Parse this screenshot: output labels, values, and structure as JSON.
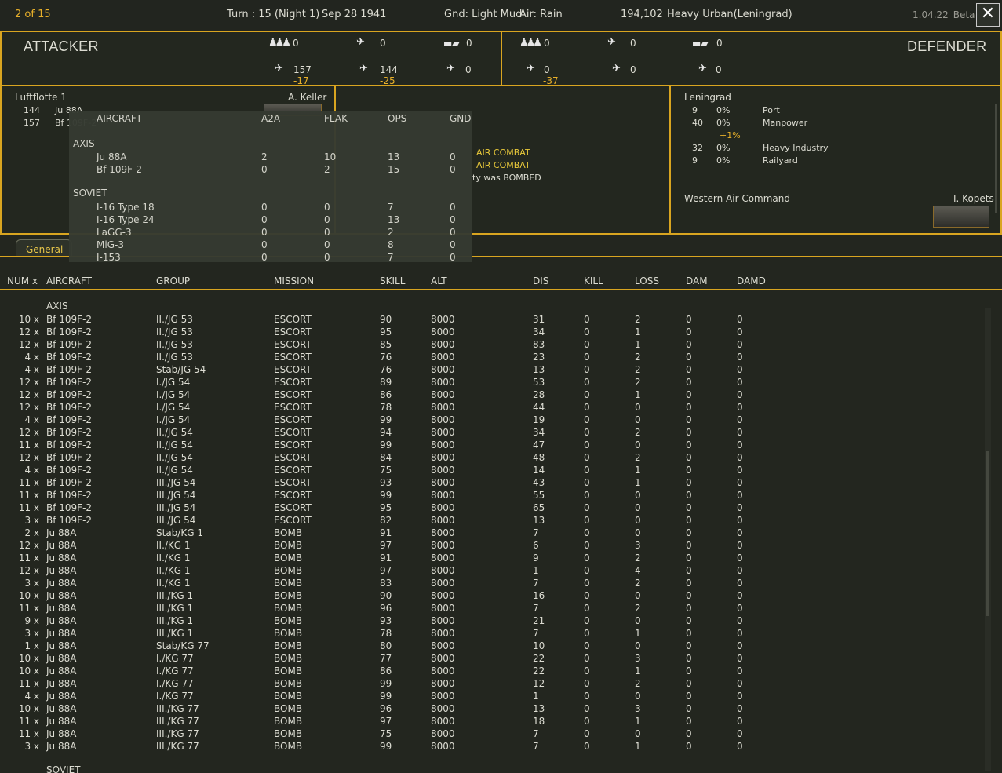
{
  "topbar": {
    "page": "2 of 15",
    "turn": "Turn : 15 (Night 1)",
    "date": "Sep 28 1941",
    "ground": "Gnd: Light Mud",
    "air": "Air: Rain",
    "hex": "194,102",
    "terrain": "Heavy Urban(Leningrad)",
    "version": "1.04.22_Beta",
    "close": "✕"
  },
  "attacker": {
    "title": "ATTACKER",
    "infantry": "0",
    "bomber_top": "0",
    "tank": "0",
    "fighter": "157",
    "fighter_loss": "-17",
    "bomber": "144",
    "bomber_loss": "-25",
    "recon": "0"
  },
  "defender": {
    "title": "DEFENDER",
    "infantry": "0",
    "bomber_top": "0",
    "tank": "0",
    "fighter": "0",
    "fighter_loss": "-37",
    "bomber": "0",
    "recon": "0"
  },
  "att_info": {
    "unit": "Luftflotte 1",
    "commander": "A. Keller",
    "rows": [
      {
        "n": "144",
        "t": "Ju 88A"
      },
      {
        "n": "157",
        "t": "Bf 109F-2"
      }
    ]
  },
  "messages": [
    "AIR COMBAT",
    "AIR COMBAT",
    "ty was BOMBED"
  ],
  "def_info": {
    "location": "Leningrad",
    "rows": [
      {
        "n": "9",
        "p": "0%",
        "t": "Port"
      },
      {
        "n": "40",
        "p": "0%",
        "t": "Manpower"
      },
      {
        "n": "",
        "p": "+1%",
        "t": ""
      },
      {
        "n": "32",
        "p": "0%",
        "t": "Heavy Industry"
      },
      {
        "n": "9",
        "p": "0%",
        "t": "Railyard"
      }
    ],
    "command": "Western Air Command",
    "commander": "I. Kopets"
  },
  "overlay": {
    "headers": [
      "AIRCRAFT",
      "A2A",
      "FLAK",
      "OPS",
      "GND"
    ],
    "axis_label": "AXIS",
    "soviet_label": "SOVIET",
    "axis": [
      [
        "Ju 88A",
        "2",
        "10",
        "13",
        "0"
      ],
      [
        "Bf 109F-2",
        "0",
        "2",
        "15",
        "0"
      ]
    ],
    "soviet": [
      [
        "I-16 Type 18",
        "0",
        "0",
        "7",
        "0"
      ],
      [
        "I-16 Type 24",
        "0",
        "0",
        "13",
        "0"
      ],
      [
        "LaGG-3",
        "0",
        "0",
        "2",
        "0"
      ],
      [
        "MiG-3",
        "0",
        "0",
        "8",
        "0"
      ],
      [
        "I-153",
        "0",
        "0",
        "7",
        "0"
      ]
    ]
  },
  "tab": {
    "label": "General In"
  },
  "table": {
    "headers": [
      "NUM x",
      "AIRCRAFT",
      "GROUP",
      "MISSION",
      "SKILL",
      "ALT",
      "DIS",
      "KILL",
      "LOSS",
      "DAM",
      "DAMD"
    ],
    "axis_label": "AXIS",
    "soviet_label": "SOVIET",
    "rows": [
      [
        "10 x",
        "Bf 109F-2",
        "II./JG 53",
        "ESCORT",
        "90",
        "8000",
        "31",
        "0",
        "2",
        "0",
        "0"
      ],
      [
        "12 x",
        "Bf 109F-2",
        "II./JG 53",
        "ESCORT",
        "95",
        "8000",
        "34",
        "0",
        "1",
        "0",
        "0"
      ],
      [
        "12 x",
        "Bf 109F-2",
        "II./JG 53",
        "ESCORT",
        "85",
        "8000",
        "83",
        "0",
        "1",
        "0",
        "0"
      ],
      [
        "4 x",
        "Bf 109F-2",
        "II./JG 53",
        "ESCORT",
        "76",
        "8000",
        "23",
        "0",
        "2",
        "0",
        "0"
      ],
      [
        "4 x",
        "Bf 109F-2",
        "Stab/JG 54",
        "ESCORT",
        "76",
        "8000",
        "13",
        "0",
        "2",
        "0",
        "0"
      ],
      [
        "12 x",
        "Bf 109F-2",
        "I./JG 54",
        "ESCORT",
        "89",
        "8000",
        "53",
        "0",
        "2",
        "0",
        "0"
      ],
      [
        "12 x",
        "Bf 109F-2",
        "I./JG 54",
        "ESCORT",
        "86",
        "8000",
        "28",
        "0",
        "1",
        "0",
        "0"
      ],
      [
        "12 x",
        "Bf 109F-2",
        "I./JG 54",
        "ESCORT",
        "78",
        "8000",
        "44",
        "0",
        "0",
        "0",
        "0"
      ],
      [
        "4 x",
        "Bf 109F-2",
        "I./JG 54",
        "ESCORT",
        "99",
        "8000",
        "19",
        "0",
        "0",
        "0",
        "0"
      ],
      [
        "12 x",
        "Bf 109F-2",
        "II./JG 54",
        "ESCORT",
        "94",
        "8000",
        "34",
        "0",
        "2",
        "0",
        "0"
      ],
      [
        "11 x",
        "Bf 109F-2",
        "II./JG 54",
        "ESCORT",
        "99",
        "8000",
        "47",
        "0",
        "0",
        "0",
        "0"
      ],
      [
        "12 x",
        "Bf 109F-2",
        "II./JG 54",
        "ESCORT",
        "84",
        "8000",
        "48",
        "0",
        "2",
        "0",
        "0"
      ],
      [
        "4 x",
        "Bf 109F-2",
        "II./JG 54",
        "ESCORT",
        "75",
        "8000",
        "14",
        "0",
        "1",
        "0",
        "0"
      ],
      [
        "11 x",
        "Bf 109F-2",
        "III./JG 54",
        "ESCORT",
        "93",
        "8000",
        "43",
        "0",
        "1",
        "0",
        "0"
      ],
      [
        "11 x",
        "Bf 109F-2",
        "III./JG 54",
        "ESCORT",
        "99",
        "8000",
        "55",
        "0",
        "0",
        "0",
        "0"
      ],
      [
        "11 x",
        "Bf 109F-2",
        "III./JG 54",
        "ESCORT",
        "95",
        "8000",
        "65",
        "0",
        "0",
        "0",
        "0"
      ],
      [
        "3 x",
        "Bf 109F-2",
        "III./JG 54",
        "ESCORT",
        "82",
        "8000",
        "13",
        "0",
        "0",
        "0",
        "0"
      ],
      [
        "2 x",
        "Ju 88A",
        "Stab/KG 1",
        "BOMB",
        "91",
        "8000",
        "7",
        "0",
        "0",
        "0",
        "0"
      ],
      [
        "12 x",
        "Ju 88A",
        "II./KG 1",
        "BOMB",
        "97",
        "8000",
        "6",
        "0",
        "3",
        "0",
        "0"
      ],
      [
        "11 x",
        "Ju 88A",
        "II./KG 1",
        "BOMB",
        "91",
        "8000",
        "9",
        "0",
        "2",
        "0",
        "0"
      ],
      [
        "12 x",
        "Ju 88A",
        "II./KG 1",
        "BOMB",
        "97",
        "8000",
        "1",
        "0",
        "4",
        "0",
        "0"
      ],
      [
        "3 x",
        "Ju 88A",
        "II./KG 1",
        "BOMB",
        "83",
        "8000",
        "7",
        "0",
        "2",
        "0",
        "0"
      ],
      [
        "10 x",
        "Ju 88A",
        "III./KG 1",
        "BOMB",
        "90",
        "8000",
        "16",
        "0",
        "0",
        "0",
        "0"
      ],
      [
        "11 x",
        "Ju 88A",
        "III./KG 1",
        "BOMB",
        "96",
        "8000",
        "7",
        "0",
        "2",
        "0",
        "0"
      ],
      [
        "9 x",
        "Ju 88A",
        "III./KG 1",
        "BOMB",
        "93",
        "8000",
        "21",
        "0",
        "0",
        "0",
        "0"
      ],
      [
        "3 x",
        "Ju 88A",
        "III./KG 1",
        "BOMB",
        "78",
        "8000",
        "7",
        "0",
        "1",
        "0",
        "0"
      ],
      [
        "1 x",
        "Ju 88A",
        "Stab/KG 77",
        "BOMB",
        "80",
        "8000",
        "10",
        "0",
        "0",
        "0",
        "0"
      ],
      [
        "10 x",
        "Ju 88A",
        "I./KG 77",
        "BOMB",
        "77",
        "8000",
        "22",
        "0",
        "3",
        "0",
        "0"
      ],
      [
        "10 x",
        "Ju 88A",
        "I./KG 77",
        "BOMB",
        "86",
        "8000",
        "22",
        "0",
        "1",
        "0",
        "0"
      ],
      [
        "11 x",
        "Ju 88A",
        "I./KG 77",
        "BOMB",
        "99",
        "8000",
        "12",
        "0",
        "2",
        "0",
        "0"
      ],
      [
        "4 x",
        "Ju 88A",
        "I./KG 77",
        "BOMB",
        "99",
        "8000",
        "1",
        "0",
        "0",
        "0",
        "0"
      ],
      [
        "10 x",
        "Ju 88A",
        "III./KG 77",
        "BOMB",
        "96",
        "8000",
        "13",
        "0",
        "3",
        "0",
        "0"
      ],
      [
        "11 x",
        "Ju 88A",
        "III./KG 77",
        "BOMB",
        "97",
        "8000",
        "18",
        "0",
        "1",
        "0",
        "0"
      ],
      [
        "11 x",
        "Ju 88A",
        "III./KG 77",
        "BOMB",
        "75",
        "8000",
        "7",
        "0",
        "0",
        "0",
        "0"
      ],
      [
        "3 x",
        "Ju 88A",
        "III./KG 77",
        "BOMB",
        "99",
        "8000",
        "7",
        "0",
        "1",
        "0",
        "0"
      ]
    ]
  }
}
